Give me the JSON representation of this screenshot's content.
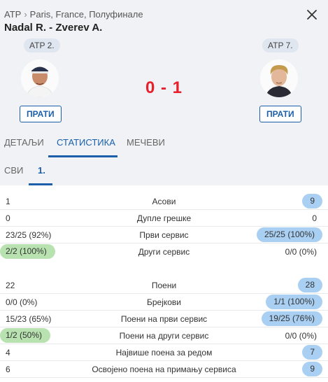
{
  "breadcrumb": {
    "sport": "ATP",
    "separator": "›",
    "event": "Paris, France, Полуфинале"
  },
  "match": {
    "title": "Nadal R. - Zverev A.",
    "score": "0 - 1"
  },
  "home": {
    "rank": "ATP 2.",
    "follow": "ПРАТИ"
  },
  "away": {
    "rank": "ATP 7.",
    "follow": "ПРАТИ"
  },
  "tabs": [
    {
      "label": "ДЕТАЉИ"
    },
    {
      "label": "СТАТИСТИКА"
    },
    {
      "label": "МЕЧЕВИ"
    }
  ],
  "subtabs": [
    {
      "label": "СВИ"
    },
    {
      "label": "1."
    }
  ],
  "stats": [
    {
      "label": "Асови",
      "home": "1",
      "away": "9",
      "leader": "away"
    },
    {
      "label": "Дупле грешке",
      "home": "0",
      "away": "0",
      "leader": "none"
    },
    {
      "label": "Први сервис",
      "home": "23/25 (92%)",
      "away": "25/25 (100%)",
      "leader": "away"
    },
    {
      "label": "Други сервис",
      "home": "2/2 (100%)",
      "away": "0/0 (0%)",
      "leader": "home"
    },
    {
      "label": "Поени",
      "home": "22",
      "away": "28",
      "leader": "away"
    },
    {
      "label": "Брејкови",
      "home": "0/0 (0%)",
      "away": "1/1 (100%)",
      "leader": "away"
    },
    {
      "label": "Поени на први сервис",
      "home": "15/23 (65%)",
      "away": "19/25 (76%)",
      "leader": "away"
    },
    {
      "label": "Поени на други сервис",
      "home": "1/2 (50%)",
      "away": "0/0 (0%)",
      "leader": "home"
    },
    {
      "label": "Највише поена за редом",
      "home": "4",
      "away": "7",
      "leader": "away"
    },
    {
      "label": "Освојено поена на примању сервиса",
      "home": "6",
      "away": "9",
      "leader": "away"
    }
  ],
  "icons": {
    "close": "close-icon"
  },
  "colors": {
    "accent": "#1a5fa8",
    "score": "#e8202b",
    "home_highlight": "#b8e2b0",
    "away_highlight": "#a9cff2"
  }
}
